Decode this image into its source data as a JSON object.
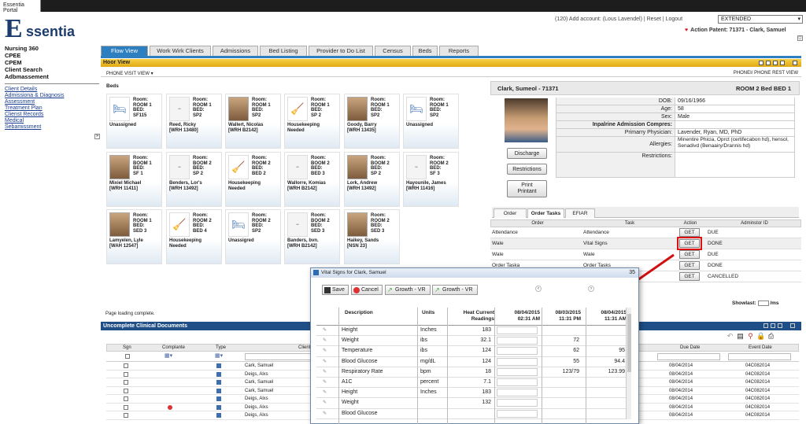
{
  "browser": {
    "tab_title": "Essentia Portal"
  },
  "logo": {
    "e": "E",
    "rest": "ssentia"
  },
  "left_nav": {
    "titles": [
      "Nursing 360",
      "CPEE",
      "CPEM",
      "Client Search",
      "Adbmassement"
    ],
    "links": [
      "Client Details",
      "Admissiona & Diagnosis",
      "Assessment",
      "Treatment Plan",
      "Clienst Records",
      "Medical",
      "Sebamissment"
    ]
  },
  "header": {
    "account_line": "(120)   Add account: (Lous Lavendel) | Reset | Logout",
    "extended": "EXTENDED",
    "action_patient": "Action Patent: 71371 - Clark, Samuel"
  },
  "tabs": [
    "Flow View",
    "Work Wirk Clients",
    "Admissions",
    "Bed Listing",
    "Provider to Do List",
    "Census",
    "Beds",
    "Reports"
  ],
  "view": {
    "title": "Hoor View",
    "subleft": "PHONE VISIT VIEW ▾",
    "subright": "PHONEI/ PHONE REST VIEW",
    "beds_label": "Beds"
  },
  "beds": [
    {
      "info": [
        "Room:",
        "ROOM 1",
        "BED:",
        "SF115"
      ],
      "name": [
        "Unassigned",
        ""
      ]
    },
    {
      "info": [
        "Room:",
        "ROOM 1",
        "BED:",
        "SP2"
      ],
      "name": [
        "Reed, Ricky",
        "[WRH 13480]"
      ]
    },
    {
      "info": [
        "Room:",
        "ROOM 1",
        "BED:",
        "SP2"
      ],
      "name": [
        "Wallert, Nicolas",
        "[WRH B2142]"
      ]
    },
    {
      "info": [
        "Room:",
        "ROOM 1",
        "BED:",
        "SP 2"
      ],
      "name": [
        "Housekeeping",
        "Needed"
      ]
    },
    {
      "info": [
        "Room:",
        "ROOM 1",
        "BED:",
        "SP2"
      ],
      "name": [
        "Goody, Barry",
        "[WRH 13435]"
      ]
    },
    {
      "info": [
        "Room:",
        "ROOM 1",
        "BED:",
        "SP2"
      ],
      "name": [
        "Unassigned",
        ""
      ]
    },
    {
      "info": [
        "Room:",
        "BOOM 1",
        "BED:",
        "SF 1"
      ],
      "name": [
        "Mixiel Michael",
        "[WRH 11411]"
      ]
    },
    {
      "info": [
        "Room:",
        "BOOM 2",
        "BED:",
        "SP 2"
      ],
      "name": [
        "Benders, Lor's",
        "[WRH 13492]"
      ]
    },
    {
      "info": [
        "Room:",
        "ROOM 2",
        "BED:",
        "BED 2"
      ],
      "name": [
        "Housekeeping",
        "Needed"
      ]
    },
    {
      "info": [
        "Room:",
        "BOOM 2",
        "BED:",
        "BED 3"
      ],
      "name": [
        "Wallorre, Komias",
        "[WRH B2142]"
      ]
    },
    {
      "info": [
        "Room:",
        "BOOM 2",
        "BED:",
        "SP 2"
      ],
      "name": [
        "Lork, Andrew",
        "[WRH 13492]"
      ]
    },
    {
      "info": [
        "Room:",
        "ROOM 2",
        "BED:",
        "SF 3"
      ],
      "name": [
        "Hayounile, James",
        "[WRH 11416]"
      ]
    },
    {
      "info": [
        "Room:",
        "ROOM 1",
        "BED:",
        "SED 3"
      ],
      "name": [
        "Lamyelen, Lyle",
        "[WAH 12547]"
      ]
    },
    {
      "info": [
        "Room:",
        "ROOM 2",
        "BED:",
        "BED 4"
      ],
      "name": [
        "Housekeeping",
        "Needed"
      ]
    },
    {
      "info": [
        "Room:",
        "ROOM 2",
        "BED:",
        "SP2"
      ],
      "name": [
        "Unassigred",
        ""
      ]
    },
    {
      "info": [
        "Room:",
        "BOOM 2",
        "BED:",
        "SED 3"
      ],
      "name": [
        "Banders, bvn.",
        "[WRH B2142]"
      ]
    },
    {
      "info": [
        "Room:",
        "ROOM 2",
        "BED:",
        "SED 3"
      ],
      "name": [
        "Haikey, Sands",
        "[NSN 23]"
      ]
    }
  ],
  "status_line": "Page loading complete.",
  "patient": {
    "header_left": "Clark, Sumeol - 71371",
    "header_right": "ROOM 2 Bed BED 1",
    "buttons": [
      "Discharge",
      "Restrictions",
      "Print",
      "Printant"
    ],
    "fields": [
      {
        "k": "DOB:",
        "v": "09/16/1966"
      },
      {
        "k": "Age:",
        "v": "58"
      },
      {
        "k": "Sex:",
        "v": "Male"
      },
      {
        "k": "Inpalrine Admission Compres:",
        "v": ""
      },
      {
        "k": "Primarry Physician:",
        "v": "Lavender, Ryan, MD, PhD"
      },
      {
        "k": "Allergies:",
        "v": "Minentire Phicia, Oprct (certifecabon hd), hensol, Senadivd (Benaairy/Drannis hd)"
      },
      {
        "k": "Restrictions:",
        "v": ""
      }
    ]
  },
  "order_tabs": [
    "Order",
    "Order Tasks",
    "EFIAR"
  ],
  "order_table": {
    "headers": [
      "Order",
      "Task",
      "Action",
      "Adminstor ID"
    ],
    "rows": [
      {
        "order": "Attendance",
        "task": "Attendance",
        "action": "GET",
        "status": "DUE"
      },
      {
        "order": "Wale",
        "task": "Vital Signs",
        "action": "GET",
        "status": "DONE"
      },
      {
        "order": "Wale",
        "task": "Wale",
        "action": "GET",
        "status": "DUE"
      },
      {
        "order": "Order Taska",
        "task": "Order Tasks",
        "action": "GET",
        "status": "DONE"
      },
      {
        "order": "",
        "task": "",
        "action": "GET",
        "status": "CANCELLED"
      }
    ]
  },
  "showlast": {
    "label": "Showlast:",
    "suffix": "/ms"
  },
  "incomplete": {
    "title": "Uncomplete Clinical Documents",
    "headers": [
      "Sgn",
      "Complante",
      "Type",
      "Client",
      "Due Date",
      "Event Date"
    ],
    "rows": [
      {
        "client": "Cark, Samuel",
        "due": "08/04/2014",
        "event": "04C082014",
        "x": false
      },
      {
        "client": "Deigs, Alxs",
        "due": "08/04/2014",
        "event": "04C082014",
        "x": false
      },
      {
        "client": "Cark, Samuel",
        "due": "08/04/2014",
        "event": "04C082014",
        "x": false
      },
      {
        "client": "Cark, Samuel",
        "due": "08/04/2014",
        "event": "04C082014",
        "x": false
      },
      {
        "client": "Deigs, Alxs",
        "due": "08/04/2014",
        "event": "04C082014",
        "x": false
      },
      {
        "client": "Deigs, Alxs",
        "due": "08/04/2014",
        "event": "04C082014",
        "x": true
      },
      {
        "client": "Deigs, Alxs",
        "due": "08/04/2014",
        "event": "04C082014",
        "x": false
      }
    ]
  },
  "vital": {
    "title": "Vital Signs for Clark, Samuel",
    "close": "35",
    "buttons": [
      "Save",
      "Cancel",
      "Growth - VR",
      "Growth - VR"
    ],
    "headers": {
      "desc": "Description",
      "units": "Units",
      "heat1": "Heat Current",
      "heat2": "Readings",
      "d1a": "08/04/2015",
      "d1b": "02:31 AM",
      "d2a": "08/03/2015",
      "d2b": "11:31 PM",
      "d3a": "08/04/2015",
      "d3b": "11:31 AM"
    },
    "rows": [
      {
        "d": "Height",
        "u": "Inches",
        "cur": "183",
        "v2": "",
        "v3": ""
      },
      {
        "d": "Weight",
        "u": "ibs",
        "cur": "32.1",
        "v2": "72",
        "v3": ""
      },
      {
        "d": "Temperature",
        "u": "ibs",
        "cur": "124",
        "v2": "62",
        "v3": "95"
      },
      {
        "d": "Blood Glucose",
        "u": "mg/dL",
        "cur": "124",
        "v2": "55",
        "v3": "94.4"
      },
      {
        "d": "Respiratory Rate",
        "u": "bpm",
        "cur": "18",
        "v2": "123/79",
        "v3": "123.99"
      },
      {
        "d": "A1C",
        "u": "percent",
        "cur": "7.1",
        "v2": "",
        "v3": ""
      },
      {
        "d": "Height",
        "u": "Inches",
        "cur": "183",
        "v2": "",
        "v3": ""
      },
      {
        "d": "Weight",
        "u": "",
        "cur": "132",
        "v2": "",
        "v3": ""
      },
      {
        "d": "Blood Glucose",
        "u": "",
        "cur": "",
        "v2": "",
        "v3": ""
      }
    ]
  },
  "colors": {
    "tab_active": "#2d7fc0",
    "header_bar": "#f0c13a",
    "doc_bar": "#1f4f86",
    "highlight": "#d11111"
  }
}
